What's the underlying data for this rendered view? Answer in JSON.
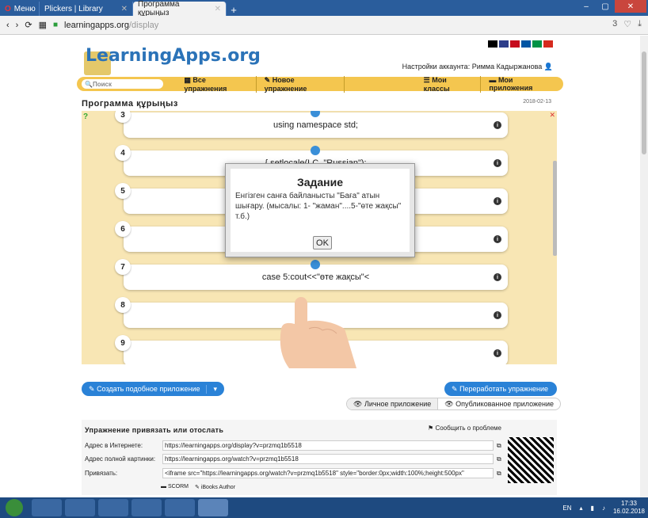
{
  "browser": {
    "tabs": [
      {
        "label": "Меню"
      },
      {
        "label": "Plickers | Library"
      },
      {
        "label": "Программа құрыңыз"
      }
    ],
    "url_host": "learningapps.org",
    "url_path": "/display",
    "badge": "3"
  },
  "site": {
    "logo": "LearningApps.org",
    "account": "Настройки аккаунта: Римма Кадыржанова",
    "search_placeholder": "Поиск",
    "menu": [
      "Все упражнения",
      "Новое упражнение",
      "Мои классы",
      "Мои приложения"
    ]
  },
  "app": {
    "title": "Программа құрыңыз",
    "date": "2018-02-13",
    "rows": [
      {
        "num": "3",
        "text": "using namespace std;"
      },
      {
        "num": "4",
        "text": "{ setlocale(LC_\"Russian\");"
      },
      {
        "num": "5",
        "text": ""
      },
      {
        "num": "6",
        "text": ""
      },
      {
        "num": "7",
        "text": "case 5:cout<<\"өте жақсы\"<"
      },
      {
        "num": "8",
        "text": ""
      },
      {
        "num": "9",
        "text": "int"
      }
    ]
  },
  "dialog": {
    "title": "Задание",
    "text": "Енгізген санға байланысты \"Баға\" атын шығару. (мысалы: 1- \"жаман\"....5-\"өте жақсы\" т.б.)",
    "ok": "OK"
  },
  "actions": {
    "create_similar": "Создать подобное приложение",
    "rework": "Переработать упражнение",
    "private": "Личное приложение",
    "published": "Опубликованное приложение"
  },
  "share": {
    "title": "Упражнение привязать или отослать",
    "report": "Сообщить о проблеме",
    "rows": [
      {
        "label": "Адрес в Интернете:",
        "value": "https://learningapps.org/display?v=przmq1b5518"
      },
      {
        "label": "Адрес полной картинки:",
        "value": "https://learningapps.org/watch?v=przmq1b5518"
      },
      {
        "label": "Привязать:",
        "value": "<iframe src=\"https://learningapps.org/watch?v=przmq1b5518\" style=\"border:0px;width:100%;height:500px\" "
      }
    ],
    "formats": [
      "SCORM",
      "iBooks Author"
    ]
  },
  "taskbar": {
    "lang": "EN",
    "time": "17:33",
    "date": "16.02.2018"
  }
}
